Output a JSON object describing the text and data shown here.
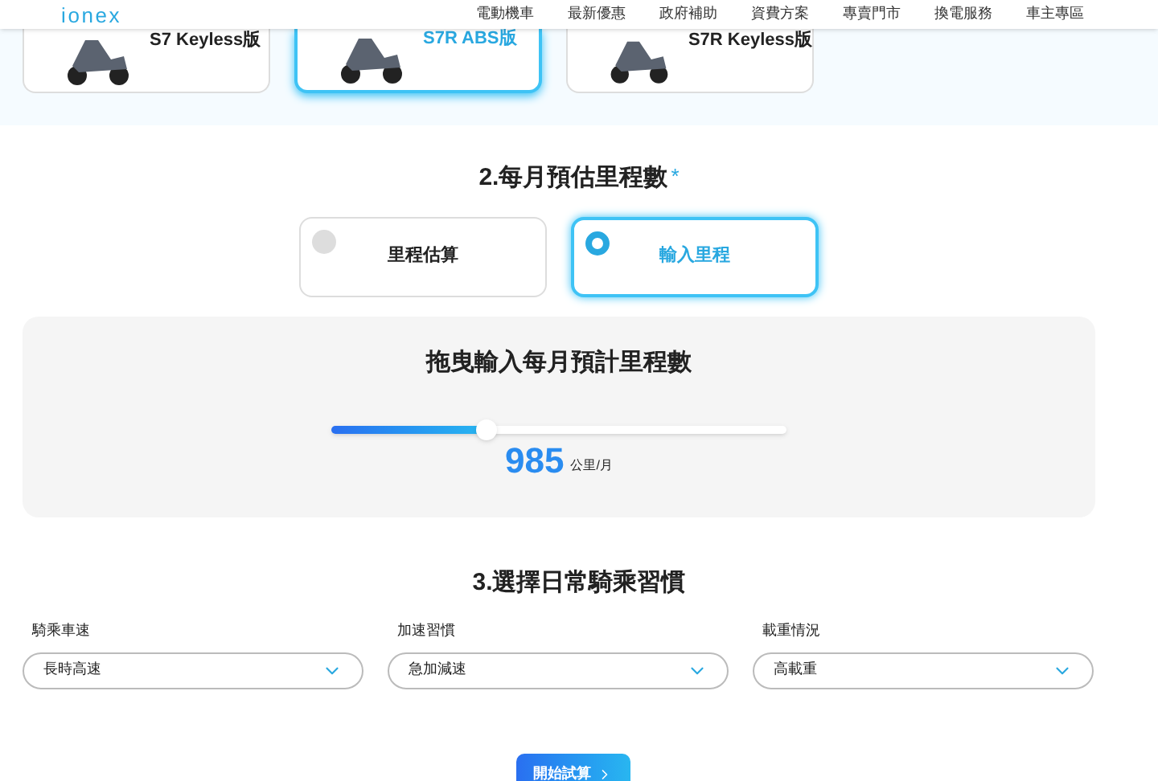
{
  "header": {
    "logo": "ionex",
    "nav": [
      "電動機車",
      "最新優惠",
      "政府補助",
      "資費方案",
      "專賣門市",
      "換電服務",
      "車主專區"
    ]
  },
  "models": [
    {
      "name": "S7 Keyless版",
      "selected": false
    },
    {
      "name": "S7R ABS版",
      "selected": true
    },
    {
      "name": "S7R Keyless版",
      "selected": false
    }
  ],
  "mileage": {
    "title": "2.每月預估里程數",
    "required": "*",
    "options": [
      {
        "label": "里程估算",
        "selected": false
      },
      {
        "label": "輸入里程",
        "selected": true
      }
    ],
    "panel": {
      "title": "拖曳輸入每月預計里程數",
      "level": 0.34,
      "value": "985",
      "unit": "公里/月"
    }
  },
  "habits": {
    "title": "3.選擇日常騎乘習慣",
    "selects": [
      {
        "label": "騎乘車速",
        "value": "長時高速"
      },
      {
        "label": "加速習慣",
        "value": "急加減速"
      },
      {
        "label": "載重情況",
        "value": "高載重"
      }
    ]
  },
  "submit": "開始試算"
}
